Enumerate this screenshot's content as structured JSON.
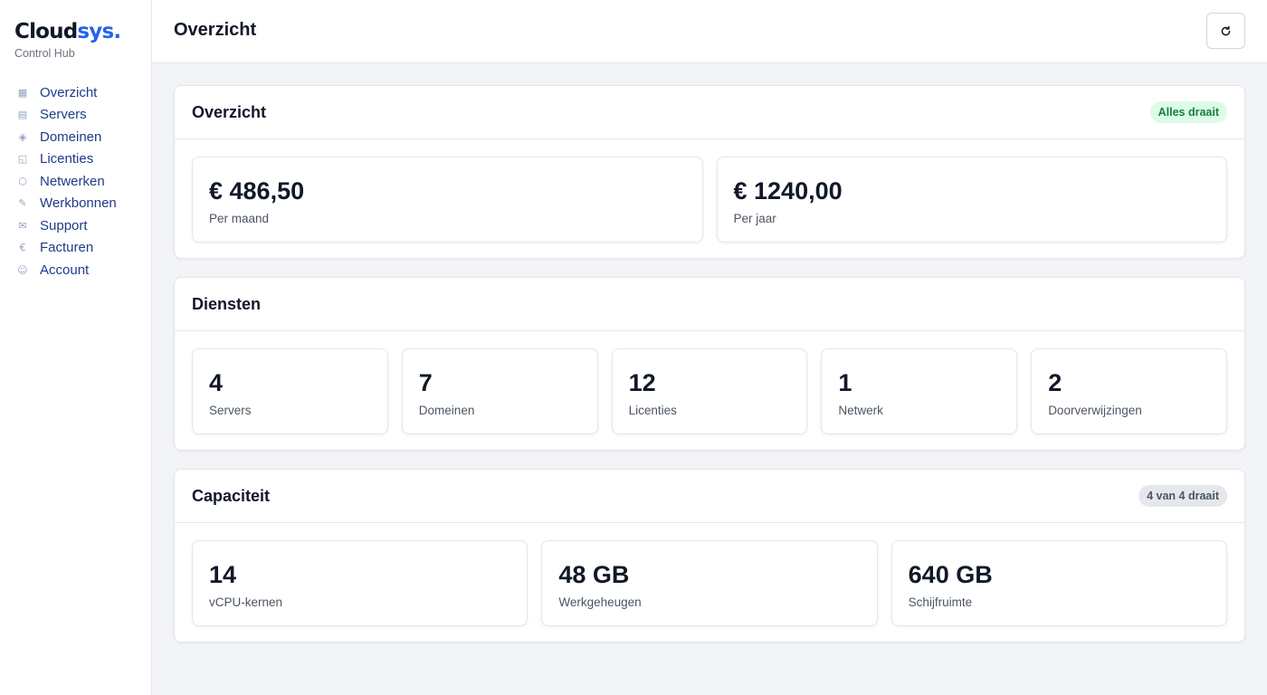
{
  "brand": {
    "name_main": "Cloud",
    "name_accent": "sys.",
    "subtitle": "Control Hub"
  },
  "sidebar": {
    "items": [
      {
        "label": "Overzicht",
        "icon": "grid-icon",
        "glyph": "▦"
      },
      {
        "label": "Servers",
        "icon": "server-icon",
        "glyph": "▤"
      },
      {
        "label": "Domeinen",
        "icon": "diamond-icon",
        "glyph": "◈"
      },
      {
        "label": "Licenties",
        "icon": "license-icon",
        "glyph": "◱"
      },
      {
        "label": "Netwerken",
        "icon": "network-icon",
        "glyph": "⬡"
      },
      {
        "label": "Werkbonnen",
        "icon": "wrench-icon",
        "glyph": "✎"
      },
      {
        "label": "Support",
        "icon": "mail-icon",
        "glyph": "✉"
      },
      {
        "label": "Facturen",
        "icon": "euro-icon",
        "glyph": "€"
      },
      {
        "label": "Account",
        "icon": "user-icon",
        "glyph": "☺"
      }
    ]
  },
  "header": {
    "title": "Overzicht",
    "refresh_icon": "refresh-icon"
  },
  "overview": {
    "title": "Overzicht",
    "badge": "Alles draait",
    "stats": [
      {
        "value": "€ 486,50",
        "label": "Per maand"
      },
      {
        "value": "€ 1240,00",
        "label": "Per jaar"
      }
    ]
  },
  "services": {
    "title": "Diensten",
    "stats": [
      {
        "value": "4",
        "label": "Servers"
      },
      {
        "value": "7",
        "label": "Domeinen"
      },
      {
        "value": "12",
        "label": "Licenties"
      },
      {
        "value": "1",
        "label": "Netwerk"
      },
      {
        "value": "2",
        "label": "Doorverwijzingen"
      }
    ]
  },
  "capacity": {
    "title": "Capaciteit",
    "badge": "4 van 4 draait",
    "stats": [
      {
        "value": "14",
        "label": "vCPU-kernen"
      },
      {
        "value": "48 GB",
        "label": "Werkgeheugen"
      },
      {
        "value": "640 GB",
        "label": "Schijfruimte"
      }
    ]
  },
  "colors": {
    "accent": "#2563eb",
    "nav_text": "#1e3a8a",
    "badge_green": "#15803d"
  }
}
